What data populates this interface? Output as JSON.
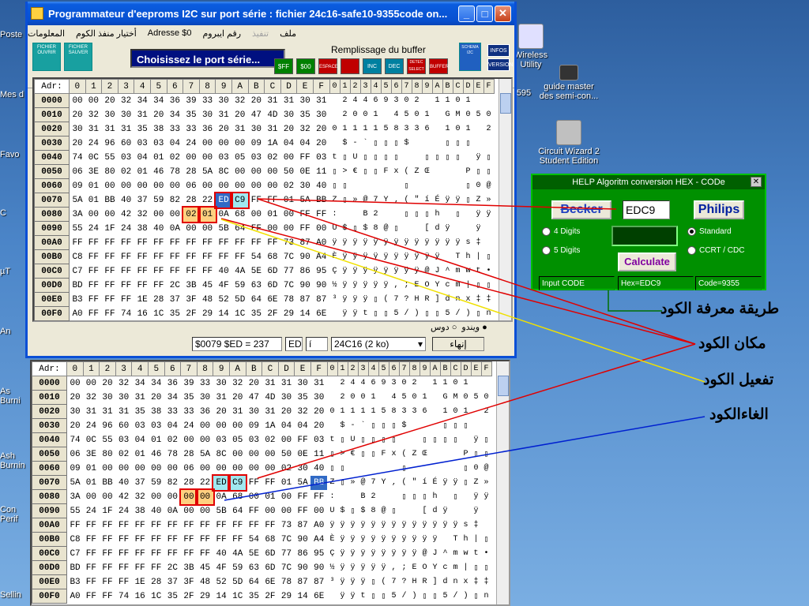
{
  "desktop": {
    "icons": [
      {
        "name": "Wireless Utility",
        "label": "Wireless\nUtility"
      },
      {
        "name": "guide master",
        "label": "guide master\ndes semi-con..."
      },
      {
        "name": "Circuit Wizard 2",
        "label": "Circuit Wizard 2\nStudent Edition"
      }
    ],
    "partial_labels": [
      "Poste",
      "Mes d",
      "Favo",
      "C",
      "µT",
      "An",
      "As\nBurni",
      "Ash\nBurnin",
      "Con\nPerif",
      "Sellin",
      "595"
    ]
  },
  "main_window": {
    "title": "Programmateur d'eeproms I2C sur port série : fichier 24c16-safe10-9355code on...",
    "controls": {
      "minimize": "_",
      "maximize": "□",
      "close": "✕"
    },
    "menu": [
      "ملف",
      "تنفيذ",
      "رقم ايبروم",
      "Adresse $0",
      "أختيار منفذ الكوم",
      "المعلومات"
    ],
    "toolbar": {
      "open_label": "FICHIER OUVRIR",
      "save_label": "FICHIER SAUVER",
      "port_label": "Choisissez le port série...",
      "fill_title": "Remplissage du buffer",
      "fill_buttons": [
        "$FF",
        "$00",
        "ESPACE",
        "INC",
        "DEC",
        "DETEC SELECT",
        "BUFFER"
      ],
      "schema_label": "SCHEMA I2C",
      "infos_label": "INFOS",
      "version_label": "VERSION"
    },
    "hex_header": {
      "addr": "Adr:",
      "cols": [
        "0",
        "1",
        "2",
        "3",
        "4",
        "5",
        "6",
        "7",
        "8",
        "9",
        "A",
        "B",
        "C",
        "D",
        "E",
        "F"
      ],
      "ascii_cols": [
        "0",
        "1",
        "2",
        "3",
        "4",
        "5",
        "6",
        "7",
        "8",
        "9",
        "A",
        "B",
        "C",
        "D",
        "E",
        "F"
      ]
    },
    "rows": [
      {
        "addr": "0000",
        "hex": [
          "00",
          "00",
          "20",
          "32",
          "34",
          "34",
          "36",
          "39",
          "33",
          "30",
          "32",
          "20",
          "31",
          "31",
          "30",
          "31"
        ],
        "ascii": " 24469302 1101"
      },
      {
        "addr": "0010",
        "hex": [
          "20",
          "32",
          "30",
          "30",
          "31",
          "20",
          "34",
          "35",
          "30",
          "31",
          "20",
          "47",
          "4D",
          "30",
          "35",
          "30"
        ],
        "ascii": " 2001 4501 GM050"
      },
      {
        "addr": "0020",
        "hex": [
          "30",
          "31",
          "31",
          "31",
          "35",
          "38",
          "33",
          "33",
          "36",
          "20",
          "31",
          "30",
          "31",
          "20",
          "32",
          "20"
        ],
        "ascii": "0111158336 101 2 "
      },
      {
        "addr": "0030",
        "hex": [
          "20",
          "24",
          "96",
          "60",
          "03",
          "03",
          "04",
          "24",
          "00",
          "00",
          "00",
          "09",
          "1A",
          "04",
          "04",
          "20"
        ],
        "ascii": " $-`▯▯▯$   ▯▯▯"
      },
      {
        "addr": "0040",
        "hex": [
          "74",
          "0C",
          "55",
          "03",
          "04",
          "01",
          "02",
          "00",
          "00",
          "03",
          "05",
          "03",
          "02",
          "00",
          "FF",
          "03"
        ],
        "ascii": "t▯U▯▯▯▯  ▯▯▯▯ ÿ▯"
      },
      {
        "addr": "0050",
        "hex": [
          "06",
          "3E",
          "80",
          "02",
          "01",
          "46",
          "78",
          "28",
          "5A",
          "8C",
          "00",
          "00",
          "00",
          "50",
          "0E",
          "11"
        ],
        "ascii": "▯>€▯▯Fx(ZŒ   P▯▯"
      },
      {
        "addr": "0060",
        "hex": [
          "09",
          "01",
          "00",
          "00",
          "00",
          "00",
          "00",
          "06",
          "00",
          "00",
          "00",
          "00",
          "00",
          "02",
          "30",
          "40"
        ],
        "ascii": "▯▯     ▯     ▯0@"
      },
      {
        "addr": "0070",
        "hex": [
          "5A",
          "01",
          "BB",
          "40",
          "37",
          "59",
          "82",
          "28",
          "22",
          "ED",
          "C9",
          "FF",
          "FF",
          "01",
          "5A",
          "BB"
        ],
        "ascii": "Z▯»@7Y‚(\"íÉÿÿ▯Z»"
      },
      {
        "addr": "0080",
        "hex": [
          "3A",
          "00",
          "00",
          "42",
          "32",
          "00",
          "00",
          "02",
          "01",
          "0A",
          "68",
          "00",
          "01",
          "00",
          "FF",
          "FF"
        ],
        "ascii": ":  B2  ▯▯▯h ▯ ÿÿ"
      },
      {
        "addr": "0090",
        "hex": [
          "55",
          "24",
          "1F",
          "24",
          "38",
          "40",
          "0A",
          "00",
          "00",
          "5B",
          "64",
          "FF",
          "00",
          "00",
          "FF",
          "00"
        ],
        "ascii": "U$▯$8@▯  [dÿ  ÿ "
      },
      {
        "addr": "00A0",
        "hex": [
          "FF",
          "FF",
          "FF",
          "FF",
          "FF",
          "FF",
          "FF",
          "FF",
          "FF",
          "FF",
          "FF",
          "FF",
          "FF",
          "73",
          "87",
          "A0"
        ],
        "ascii": "ÿÿÿÿÿÿÿÿÿÿÿÿÿs‡ "
      },
      {
        "addr": "00B0",
        "hex": [
          "C8",
          "FF",
          "FF",
          "FF",
          "FF",
          "FF",
          "FF",
          "FF",
          "FF",
          "FF",
          "FF",
          "54",
          "68",
          "7C",
          "90",
          "A4"
        ],
        "ascii": "Èÿÿÿÿÿÿÿÿÿÿ Th|▯¤"
      },
      {
        "addr": "00C0",
        "hex": [
          "C7",
          "FF",
          "FF",
          "FF",
          "FF",
          "FF",
          "FF",
          "FF",
          "FF",
          "40",
          "4A",
          "5E",
          "6D",
          "77",
          "86",
          "95"
        ],
        "ascii": "Çÿÿÿÿÿÿÿÿ@J^mwt•"
      },
      {
        "addr": "00D0",
        "hex": [
          "BD",
          "FF",
          "FF",
          "FF",
          "FF",
          "FF",
          "2C",
          "3B",
          "45",
          "4F",
          "59",
          "63",
          "6D",
          "7C",
          "90",
          "90"
        ],
        "ascii": "½ÿÿÿÿÿ,;EOYcm|▯▯"
      },
      {
        "addr": "00E0",
        "hex": [
          "B3",
          "FF",
          "FF",
          "FF",
          "1E",
          "28",
          "37",
          "3F",
          "48",
          "52",
          "5D",
          "64",
          "6E",
          "78",
          "87",
          "87"
        ],
        "ascii": "³ÿÿÿ▯(7?HR]dnx‡‡"
      },
      {
        "addr": "00F0",
        "hex": [
          "A0",
          "FF",
          "FF",
          "74",
          "16",
          "1C",
          "35",
          "2F",
          "29",
          "14",
          "1C",
          "35",
          "2F",
          "29",
          "14",
          "6E"
        ],
        "ascii": " ÿÿt▯▯5/)▯▯5/)▯n"
      }
    ],
    "rows_bottom_0080": [
      "3A",
      "00",
      "00",
      "42",
      "32",
      "00",
      "00",
      "00",
      "00",
      "0A",
      "68",
      "00",
      "01",
      "00",
      "FF",
      "FF"
    ],
    "status": {
      "addr": "$0079",
      "value": "$ED = 237",
      "byte": "ED",
      "char": "í",
      "chip": "24C16 (2 ko)",
      "exit": "إنهاء",
      "radio_win": "ويندو",
      "radio_dos": "دوس"
    }
  },
  "help_window": {
    "title": "HELP Algoritm conversion HEX - CODe",
    "becker": "Becker",
    "code_value": "EDC9",
    "philips": "Philips",
    "opt4": "4 Digits",
    "opt5": "5 Digits",
    "standard": "Standard",
    "ccrt": "CCRT / CDC",
    "calculate": "Calculate",
    "status": [
      "Input CODE",
      "Hex=EDC9",
      "Code=9355"
    ]
  },
  "annotations": {
    "method": "طريقة معرفة الكود",
    "location": "مكان الكود",
    "activate": "تفعيل الكود",
    "cancel": "الغاءالكود"
  },
  "colors": {
    "accent": "#0a4fd6",
    "selection": "#316ac5",
    "help_bg": "#009000",
    "red_line": "#e00000",
    "yellow_line": "#f0e000",
    "blue_line": "#0020d0",
    "green_line": "#007000"
  }
}
